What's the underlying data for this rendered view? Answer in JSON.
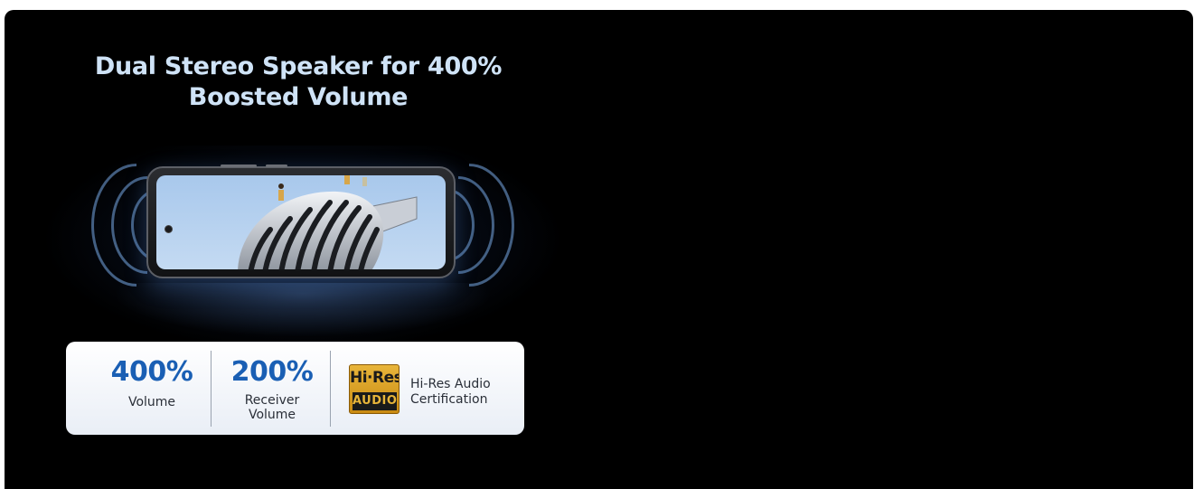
{
  "headline": {
    "line1": "Dual Stereo Speaker for 400%",
    "line2": "Boosted Volume"
  },
  "stats": [
    {
      "value": "400%",
      "label_lines": [
        "Volume"
      ]
    },
    {
      "value": "200%",
      "label_lines": [
        "Receiver",
        "Volume"
      ]
    }
  ],
  "certification": {
    "badge_top": "Hi·Res",
    "badge_bottom": "AUDIO",
    "label_lines": [
      "Hi-Res Audio",
      "Certification"
    ]
  },
  "colors": {
    "background": "#000000",
    "headline": "#cfe3f7",
    "stat_value": "#1a5fb4",
    "badge_gold": "#e8b53a"
  },
  "icons": [
    "sound-wave-icon",
    "phone-image",
    "microphone-image",
    "hi-res-audio-badge"
  ]
}
